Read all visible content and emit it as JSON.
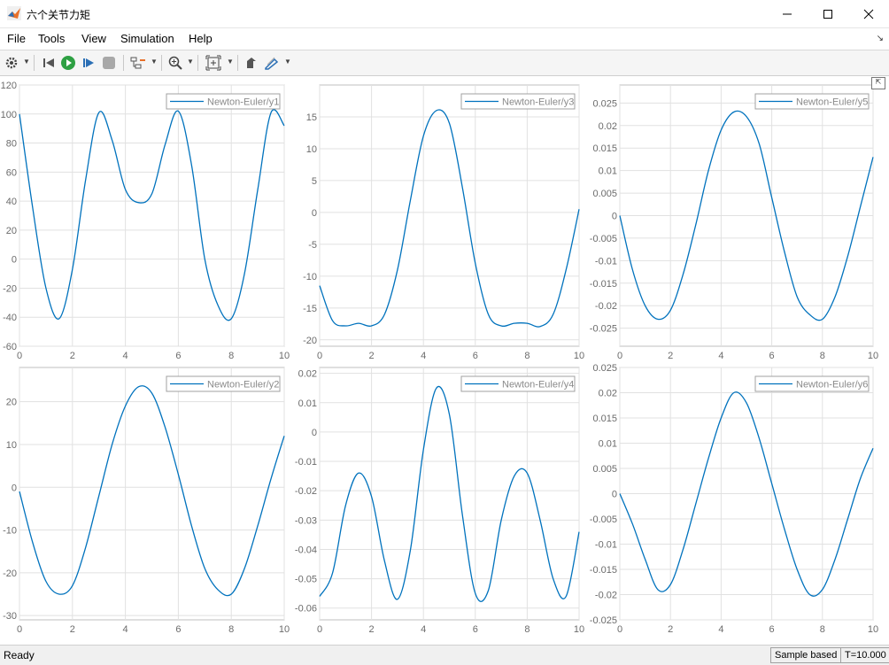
{
  "window": {
    "title": "六个关节力矩",
    "minimize_icon": "minimize-icon",
    "maximize_icon": "maximize-icon",
    "close_icon": "close-icon"
  },
  "menu": {
    "items": [
      "File",
      "Tools",
      "View",
      "Simulation",
      "Help"
    ]
  },
  "toolbar": {
    "icons": [
      "gear-icon",
      "step-back-icon",
      "run-icon",
      "step-forward-icon",
      "stop-icon",
      "signal-select-icon",
      "zoom-in-icon",
      "fit-view-icon",
      "highlight-icon",
      "style-icon"
    ]
  },
  "status": {
    "ready": "Ready",
    "sample_mode": "Sample based",
    "time": "T=10.000"
  },
  "colors": {
    "line": "#0072bd",
    "grid": "#e1e1e1",
    "axis": "#bfbfbf"
  },
  "chart_data": [
    {
      "type": "line",
      "legend": "Newton-Euler/y1",
      "xlim": [
        0,
        10
      ],
      "ylim": [
        -60,
        120
      ],
      "xticks": [
        0,
        2,
        4,
        6,
        8,
        10
      ],
      "yticks": [
        -60,
        -40,
        -20,
        0,
        20,
        40,
        60,
        80,
        100,
        120
      ],
      "series": [
        {
          "name": "Newton-Euler/y1",
          "x": [
            0,
            0.5,
            1,
            1.5,
            2,
            2.5,
            3,
            3.5,
            4,
            4.5,
            5,
            5.5,
            6,
            6.5,
            7,
            7.5,
            8,
            8.5,
            9,
            9.5,
            10
          ],
          "y": [
            100,
            35,
            -20,
            -41,
            -7,
            55,
            101,
            82,
            48,
            39,
            45,
            79,
            102,
            65,
            0,
            -32,
            -41,
            -10,
            48,
            101,
            92
          ]
        }
      ]
    },
    {
      "type": "line",
      "legend": "Newton-Euler/y2",
      "xlim": [
        0,
        10
      ],
      "ylim": [
        -31,
        28
      ],
      "xticks": [
        0,
        2,
        4,
        6,
        8,
        10
      ],
      "yticks": [
        -30,
        -20,
        -10,
        0,
        10,
        20
      ],
      "series": [
        {
          "name": "Newton-Euler/y2",
          "x": [
            0,
            0.5,
            1,
            1.5,
            2,
            2.5,
            3,
            3.5,
            4,
            4.5,
            5,
            5.5,
            6,
            6.5,
            7,
            7.5,
            8,
            8.5,
            9,
            9.5,
            10
          ],
          "y": [
            -1,
            -13,
            -22,
            -25,
            -23,
            -14,
            -2,
            10,
            19,
            23.5,
            22,
            14,
            3,
            -9,
            -19,
            -24,
            -25,
            -19,
            -9,
            2,
            12
          ]
        }
      ]
    },
    {
      "type": "line",
      "legend": "Newton-Euler/y3",
      "xlim": [
        0,
        10
      ],
      "ylim": [
        -21,
        20
      ],
      "xticks": [
        0,
        2,
        4,
        6,
        8,
        10
      ],
      "yticks": [
        -20,
        -15,
        -10,
        -5,
        0,
        5,
        10,
        15
      ],
      "series": [
        {
          "name": "Newton-Euler/y3",
          "x": [
            0,
            0.5,
            1,
            1.5,
            2,
            2.5,
            3,
            3.5,
            4,
            4.5,
            5,
            5.5,
            6,
            6.5,
            7,
            7.5,
            8,
            8.5,
            9,
            9.5,
            10
          ],
          "y": [
            -11.5,
            -17,
            -17.8,
            -17.4,
            -17.8,
            -16,
            -9,
            2,
            12,
            16,
            14,
            4,
            -8,
            -16,
            -17.8,
            -17.4,
            -17.4,
            -17.9,
            -16,
            -9,
            0.5
          ]
        }
      ]
    },
    {
      "type": "line",
      "legend": "Newton-Euler/y4",
      "xlim": [
        0,
        10
      ],
      "ylim": [
        -0.064,
        0.022
      ],
      "xticks": [
        0,
        2,
        4,
        6,
        8,
        10
      ],
      "yticks": [
        -0.06,
        -0.05,
        -0.04,
        -0.03,
        -0.02,
        -0.01,
        0,
        0.01,
        0.02
      ],
      "series": [
        {
          "name": "Newton-Euler/y4",
          "x": [
            0,
            0.5,
            1,
            1.5,
            2,
            2.5,
            3,
            3.5,
            4,
            4.5,
            5,
            5.5,
            6,
            6.5,
            7,
            7.5,
            8,
            8.5,
            9,
            9.5,
            10
          ],
          "y": [
            -0.056,
            -0.048,
            -0.025,
            -0.014,
            -0.022,
            -0.044,
            -0.057,
            -0.04,
            -0.006,
            0.015,
            0.006,
            -0.028,
            -0.055,
            -0.054,
            -0.03,
            -0.015,
            -0.014,
            -0.03,
            -0.05,
            -0.056,
            -0.034
          ]
        }
      ]
    },
    {
      "type": "line",
      "legend": "Newton-Euler/y5",
      "xlim": [
        0,
        10
      ],
      "ylim": [
        -0.029,
        0.029
      ],
      "xticks": [
        0,
        2,
        4,
        6,
        8,
        10
      ],
      "yticks": [
        -0.025,
        -0.02,
        -0.015,
        -0.01,
        -0.005,
        0,
        0.005,
        0.01,
        0.015,
        0.02,
        0.025
      ],
      "series": [
        {
          "name": "Newton-Euler/y5",
          "x": [
            0,
            0.5,
            1,
            1.5,
            2,
            2.5,
            3,
            3.5,
            4,
            4.5,
            5,
            5.5,
            6,
            6.5,
            7,
            7.5,
            8,
            8.5,
            9,
            9.5,
            10
          ],
          "y": [
            0,
            -0.012,
            -0.02,
            -0.023,
            -0.021,
            -0.013,
            -0.002,
            0.01,
            0.019,
            0.023,
            0.022,
            0.016,
            0.004,
            -0.008,
            -0.018,
            -0.022,
            -0.023,
            -0.018,
            -0.009,
            0.002,
            0.013
          ]
        }
      ]
    },
    {
      "type": "line",
      "legend": "Newton-Euler/y6",
      "xlim": [
        0,
        10
      ],
      "ylim": [
        -0.025,
        0.025
      ],
      "xticks": [
        0,
        2,
        4,
        6,
        8,
        10
      ],
      "yticks": [
        -0.025,
        -0.02,
        -0.015,
        -0.01,
        -0.005,
        0,
        0.005,
        0.01,
        0.015,
        0.02,
        0.025
      ],
      "series": [
        {
          "name": "Newton-Euler/y6",
          "x": [
            0,
            0.5,
            1,
            1.5,
            2,
            2.5,
            3,
            3.5,
            4,
            4.5,
            5,
            5.5,
            6,
            6.5,
            7,
            7.5,
            8,
            8.5,
            9,
            9.5,
            10
          ],
          "y": [
            0,
            -0.006,
            -0.013,
            -0.019,
            -0.018,
            -0.011,
            -0.002,
            0.007,
            0.015,
            0.02,
            0.018,
            0.011,
            0.002,
            -0.007,
            -0.015,
            -0.02,
            -0.019,
            -0.013,
            -0.005,
            0.003,
            0.009
          ]
        }
      ]
    }
  ]
}
